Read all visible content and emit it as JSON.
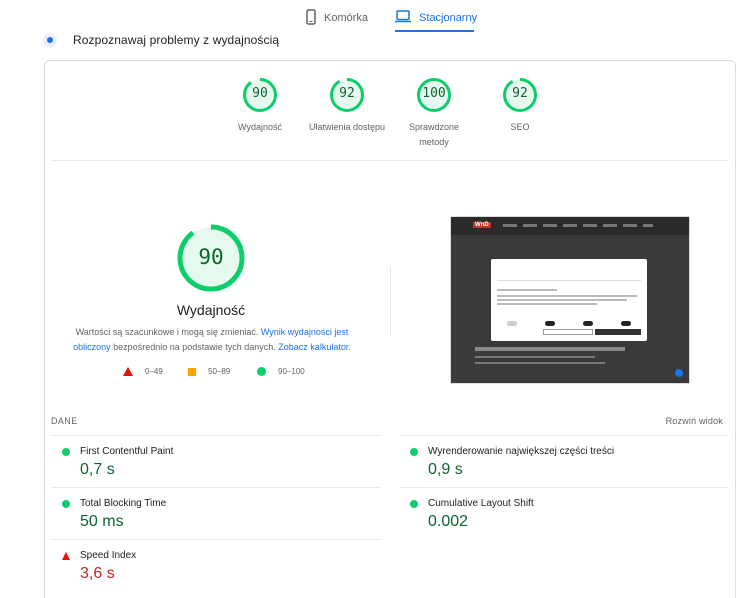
{
  "tabs": {
    "mobile": {
      "label": "Komórka",
      "icon": "smartphone-icon"
    },
    "desktop": {
      "label": "Stacjonarny",
      "icon": "laptop-icon",
      "active": true
    }
  },
  "diagnose": {
    "title": "Rozpoznawaj problemy z wydajnością",
    "icon": "diagnostics-icon"
  },
  "summary": [
    {
      "score": "90",
      "label": "Wydajność",
      "label2": "",
      "fraction": 0.9
    },
    {
      "score": "92",
      "label": "Ułatwienia dostępu",
      "label2": "",
      "fraction": 0.92
    },
    {
      "score": "100",
      "label": "Sprawdzone",
      "label2": "metody",
      "fraction": 1.0
    },
    {
      "score": "92",
      "label": "SEO",
      "label2": "",
      "fraction": 0.92
    }
  ],
  "performance": {
    "score": "90",
    "fraction": 0.9,
    "title": "Wydajność",
    "desc_part1": "Wartości są szacunkowe i mogą się zmieniać.",
    "link1": "Wynik wydajności jest obliczony",
    "desc_part2": "bezpośrednio na podstawie tych danych.",
    "link2": "Zobacz kalkulator",
    "desc_end": "."
  },
  "legend": {
    "fail": "0–49",
    "average": "50–89",
    "pass": "90–100"
  },
  "metrics_section": {
    "heading": "DANE",
    "expand": "Rozwiń widok"
  },
  "metrics": [
    {
      "name": "First Contentful Paint",
      "value": "0,7 s",
      "status": "pass"
    },
    {
      "name": "Wyrenderowanie największej części treści",
      "value": "0,9 s",
      "status": "pass"
    },
    {
      "name": "Total Blocking Time",
      "value": "50 ms",
      "status": "pass"
    },
    {
      "name": "Cumulative Layout Shift",
      "value": "0.002",
      "status": "pass"
    },
    {
      "name": "Speed Index",
      "value": "3,6 s",
      "status": "fail"
    }
  ],
  "colors": {
    "pass": "#0cce6b",
    "pass_text": "#0d652d",
    "average": "#ffa400",
    "fail": "#eb0f00",
    "accent": "#1a73e8"
  }
}
